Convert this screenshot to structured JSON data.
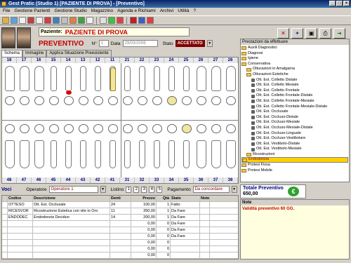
{
  "window": {
    "title": "Gest Pratic (Studio 1) [PAZIENTE DI PROVA] - [Preventivo]"
  },
  "menu": [
    "File",
    "Gestione Pazienti",
    "Gestione Studio",
    "Magazzino",
    "Agenda e Richiami",
    "Archivi",
    "Utilità",
    "?"
  ],
  "patient": {
    "label": "Paziente:",
    "name": "PAZIENTE DI PROVA"
  },
  "preventivo": {
    "title": "PREVENTIVO",
    "n_label": "N°",
    "n_value": "1",
    "data_label": "Data",
    "data_value": "29/03/2006",
    "stato_label": "Stato",
    "stato_value": "ACCETTATO"
  },
  "tabs": [
    "Schema",
    "Immagine",
    "Applica Situazione Preesistente"
  ],
  "teeth_top": [
    "18",
    "17",
    "16",
    "15",
    "14",
    "13",
    "12",
    "11",
    "21",
    "22",
    "23",
    "24",
    "25",
    "26",
    "27",
    "28"
  ],
  "teeth_bottom": [
    "48",
    "47",
    "46",
    "45",
    "44",
    "43",
    "42",
    "41",
    "31",
    "32",
    "33",
    "34",
    "35",
    "36",
    "37",
    "38"
  ],
  "voci": {
    "label": "Voci",
    "operatore_label": "Operatore",
    "operatore_value": "Operatore 1",
    "listino_label": "Listino",
    "listino_values": [
      "1",
      "2",
      "3",
      "4",
      "5"
    ],
    "pagamento_label": "Pagamento",
    "pagamento_value": "Da concordare"
  },
  "grid": {
    "headers": [
      "Codice",
      "Descrizione",
      "Denti",
      "Prezzo",
      "Qtà",
      "Stato",
      "Note"
    ],
    "rows": [
      [
        "OTTESO",
        "Ott. Est. Occlusale",
        "24",
        "100,00",
        "1",
        "Fatto",
        ""
      ],
      [
        "RICESVOR",
        "Ricostruzione Estetica con vite in Oro",
        "11",
        "350,00",
        "1",
        "Da Fare",
        ""
      ],
      [
        "ENDODEC",
        "Endodonzia Deciduo",
        "14",
        "200,00",
        "1",
        "Da Fare",
        ""
      ],
      [
        "",
        "",
        "",
        "0,00",
        "0",
        "Da Fare",
        ""
      ],
      [
        "",
        "",
        "",
        "0,00",
        "0",
        "Da Fare",
        ""
      ],
      [
        "",
        "",
        "",
        "0,00",
        "0",
        "Da Fare",
        ""
      ],
      [
        "",
        "",
        "",
        "0,00",
        "0",
        "",
        ""
      ],
      [
        "",
        "",
        "",
        "0,00",
        "0",
        "",
        ""
      ],
      [
        "",
        "",
        "",
        "0,00",
        "0",
        "",
        ""
      ],
      [
        "",
        "",
        "",
        "0,00",
        "0",
        "",
        ""
      ]
    ]
  },
  "side": {
    "header": "Prestazioni da effettuare",
    "tree": [
      {
        "t": "Auxili Diagnostici",
        "k": "folder",
        "lvl": 0
      },
      {
        "t": "Diagnosi",
        "k": "folder",
        "lvl": 0
      },
      {
        "t": "Igiene",
        "k": "folder",
        "lvl": 0
      },
      {
        "t": "Conservativa",
        "k": "folder",
        "lvl": 0
      },
      {
        "t": "Otturazioni in Amalgama",
        "k": "folder",
        "lvl": 1
      },
      {
        "t": "Otturazioni Estetiche",
        "k": "folder",
        "lvl": 1
      },
      {
        "t": "Ott. Est. Colletto Distale",
        "k": "leaf",
        "lvl": 2
      },
      {
        "t": "Ott. Est. Colletto Mesiale",
        "k": "leaf",
        "lvl": 2
      },
      {
        "t": "Ott. Est. Colletto Frontale",
        "k": "leaf",
        "lvl": 2
      },
      {
        "t": "Ott. Est. Colletto Frontale-Distale",
        "k": "leaf",
        "lvl": 2
      },
      {
        "t": "Ott. Est. Colletto Frontale-Mesiale",
        "k": "leaf",
        "lvl": 2
      },
      {
        "t": "Ott. Est. Colletto Frontale-Mesiale-Distale",
        "k": "leaf",
        "lvl": 2
      },
      {
        "t": "Ott. Est. Occlusale",
        "k": "leaf",
        "lvl": 2
      },
      {
        "t": "Ott. Est. Occluso-Distale",
        "k": "leaf",
        "lvl": 2
      },
      {
        "t": "Ott. Est. Occluso-Mesiale",
        "k": "leaf",
        "lvl": 2
      },
      {
        "t": "Ott. Est. Occluso-Mesiale-Distale",
        "k": "leaf",
        "lvl": 2
      },
      {
        "t": "Ott. Est. Occluso-Linguale",
        "k": "leaf",
        "lvl": 2
      },
      {
        "t": "Ott. Est. Occluso-Vestibolare",
        "k": "leaf",
        "lvl": 2
      },
      {
        "t": "Ott. Est. Vestibolo-Distale",
        "k": "leaf",
        "lvl": 2
      },
      {
        "t": "Ott. Est. Vestibolo-Mesiale",
        "k": "leaf",
        "lvl": 2
      },
      {
        "t": "Ricostruzioni",
        "k": "folder",
        "lvl": 1
      },
      {
        "t": "Endodonzia",
        "k": "folder",
        "lvl": 0,
        "sel": true
      },
      {
        "t": "Protesi Fissa",
        "k": "folder",
        "lvl": 0
      },
      {
        "t": "Protesi Mobile",
        "k": "folder",
        "lvl": 0
      }
    ]
  },
  "totale": {
    "label": "Totale Preventivo",
    "value": "650,00"
  },
  "note": {
    "label": "Note",
    "text": "Validità preventivo 60 GG."
  },
  "colors": {
    "accent": "#c00000",
    "title_bar": "#0a246a",
    "highlight": "#ffd000"
  }
}
